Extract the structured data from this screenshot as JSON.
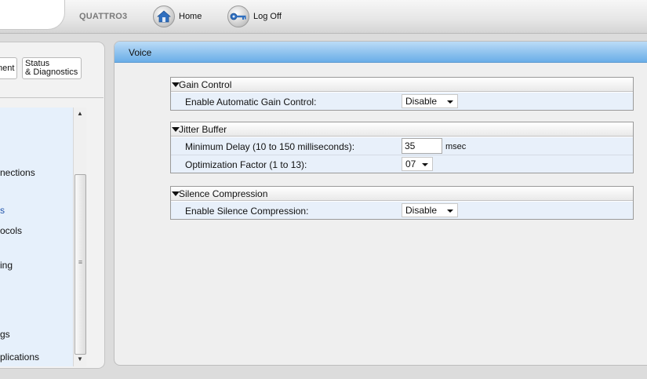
{
  "header": {
    "device_name": "QUATTRO3",
    "home_label": "Home",
    "logoff_label": "Log Off"
  },
  "sidebar": {
    "tabs": [
      {
        "label": "ment"
      },
      {
        "label": "Status\n& Diagnostics"
      }
    ],
    "items": [
      {
        "label": "nections"
      },
      {
        "label": "s"
      },
      {
        "label": "ocols"
      },
      {
        "label": "ing"
      },
      {
        "label": "gs"
      },
      {
        "label": "plications"
      }
    ]
  },
  "page": {
    "title": "Voice"
  },
  "groups": {
    "gain": {
      "title": "Gain Control",
      "agc_label": "Enable Automatic Gain Control:",
      "agc_value": "Disable"
    },
    "jitter": {
      "title": "Jitter Buffer",
      "min_delay_label": "Minimum Delay (10 to 150 milliseconds):",
      "min_delay_value": "35",
      "min_delay_unit": "msec",
      "opt_factor_label": "Optimization Factor (1 to 13):",
      "opt_factor_value": "07"
    },
    "silence": {
      "title": "Silence Compression",
      "enable_label": "Enable Silence Compression:",
      "enable_value": "Disable"
    }
  },
  "colors": {
    "header_blue": "#8ec2ee",
    "row_bg": "#e8f0fa",
    "nav_bg": "#e6f0fb"
  }
}
